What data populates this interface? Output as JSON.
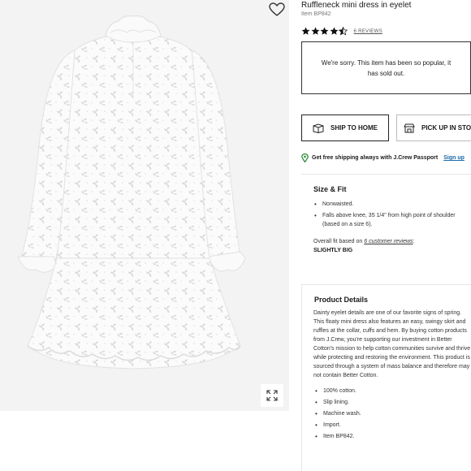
{
  "product": {
    "title": "Ruffleneck mini dress in eyelet",
    "item_number": "Item BP842",
    "rating_stars": 4.5,
    "reviews_link": "6 REVIEWS"
  },
  "icons": {
    "favorite": "heart-icon",
    "expand": "expand-arrows-icon",
    "ship": "box-icon",
    "pickup": "store-icon",
    "location": "map-pin-icon"
  },
  "availability": {
    "message": "We're sorry. This item has been so popular, it has sold out."
  },
  "fulfillment": {
    "ship_label": "SHIP TO HOME",
    "pickup_label": "PICK UP IN STORE"
  },
  "shipping": {
    "text": "Get free shipping always with J.Crew Passport",
    "link": "Sign up"
  },
  "size_fit": {
    "heading": "Size & Fit",
    "bullets": [
      "Nonwaisted.",
      "Falls above knee, 35 1/4\" from high point of shoulder (based on a size 6)."
    ],
    "fit_prefix": "Overall fit based on ",
    "fit_link": "6 customer reviews",
    "fit_suffix": ":",
    "fit_value": "SLIGHTLY BIG"
  },
  "details": {
    "heading": "Product Details",
    "description": "Dainty eyelet details are one of our favorite signs of spring. This floaty mini dress also features an easy, swingy skirt and ruffles at the collar, cuffs and hem. By buying cotton products from J.Crew, you're supporting our investment in Better Cotton's mission to help cotton communities survive and thrive while protecting and restoring the environment. This product is sourced through a system of mass balance and therefore may not contain Better Cotton.",
    "bullets": [
      "100% cotton.",
      "Slip lining.",
      "Machine wash.",
      "Import.",
      "Item BP842."
    ]
  },
  "colors": {
    "image_bg": "#f3f3f3",
    "accent_link": "#1a6aa8",
    "pin_green": "#2e8b3a",
    "star": "#111111"
  }
}
